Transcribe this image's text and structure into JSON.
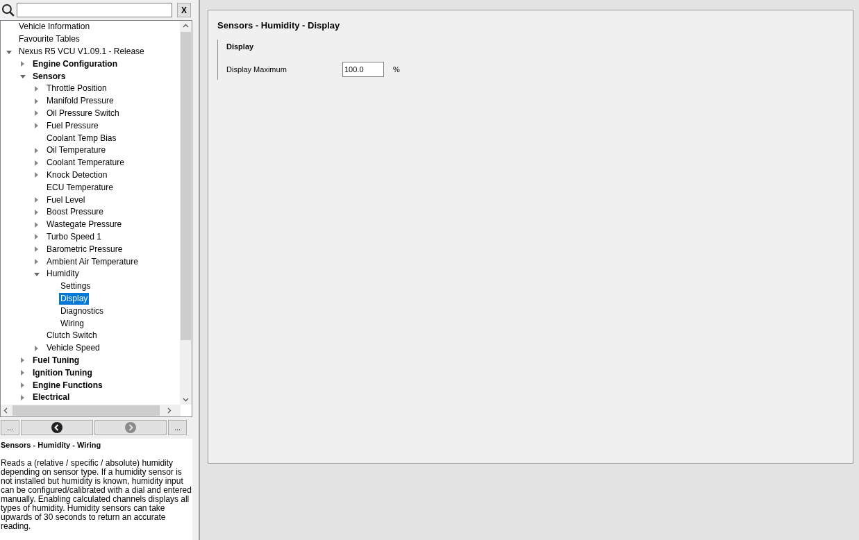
{
  "search": {
    "clear_button": "X"
  },
  "tree": [
    {
      "label": "Vehicle Information",
      "selected": false
    },
    {
      "label": "Favourite Tables",
      "selected": false
    },
    {
      "label": "Nexus R5 VCU V1.09.1 - Release",
      "selected": false,
      "expanded": true,
      "children": [
        {
          "label": "Engine Configuration",
          "selected": false,
          "expanded": false
        },
        {
          "label": "Sensors",
          "selected": false,
          "expanded": true,
          "children": [
            {
              "label": "Throttle Position",
              "selected": false,
              "expanded": false
            },
            {
              "label": "Manifold Pressure",
              "selected": false,
              "expanded": false
            },
            {
              "label": "Oil Pressure Switch",
              "selected": false,
              "expanded": false
            },
            {
              "label": "Fuel Pressure",
              "selected": false,
              "expanded": false
            },
            {
              "label": "Coolant Temp Bias",
              "selected": false
            },
            {
              "label": "Oil Temperature",
              "selected": false,
              "expanded": false
            },
            {
              "label": "Coolant Temperature",
              "selected": false,
              "expanded": false
            },
            {
              "label": "Knock Detection",
              "selected": false,
              "expanded": false
            },
            {
              "label": "ECU Temperature",
              "selected": false
            },
            {
              "label": "Fuel Level",
              "selected": false,
              "expanded": false
            },
            {
              "label": "Boost Pressure",
              "selected": false,
              "expanded": false
            },
            {
              "label": "Wastegate Pressure",
              "selected": false,
              "expanded": false
            },
            {
              "label": "Turbo Speed 1",
              "selected": false,
              "expanded": false
            },
            {
              "label": "Barometric Pressure",
              "selected": false,
              "expanded": false
            },
            {
              "label": "Ambient Air Temperature",
              "selected": false,
              "expanded": false
            },
            {
              "label": "Humidity",
              "selected": false,
              "expanded": true,
              "children": [
                {
                  "label": "Settings",
                  "selected": false
                },
                {
                  "label": "Display",
                  "selected": true
                },
                {
                  "label": "Diagnostics",
                  "selected": false
                },
                {
                  "label": "Wiring",
                  "selected": false
                }
              ]
            },
            {
              "label": "Clutch Switch",
              "selected": false
            },
            {
              "label": "Vehicle Speed",
              "selected": false,
              "expanded": false
            }
          ]
        },
        {
          "label": "Fuel Tuning",
          "selected": false,
          "expanded": false
        },
        {
          "label": "Ignition Tuning",
          "selected": false,
          "expanded": false
        },
        {
          "label": "Engine Functions",
          "selected": false,
          "expanded": false
        },
        {
          "label": "Electrical",
          "selected": false,
          "expanded": false
        }
      ]
    }
  ],
  "nav": {
    "left_more": "...",
    "right_more": "...",
    "back_disabled": false,
    "forward_disabled": true
  },
  "help": {
    "title": "Sensors - Humidity - Wiring",
    "text": "Reads a (relative / specific / absolute) humidity depending on sensor type. If a humidity sensor is not installed but humidity is known, humidity input can be configured/calibrated with a dial and entered manually. Enabling calculated channels displays all types of humidity. Humidity sensors can take upwards of 30 seconds to return an accurate reading."
  },
  "page": {
    "title": "Sensors - Humidity - Display",
    "group": "Display",
    "fields": [
      {
        "label": "Display Maximum",
        "value": "100.0",
        "unit": "%"
      }
    ]
  }
}
